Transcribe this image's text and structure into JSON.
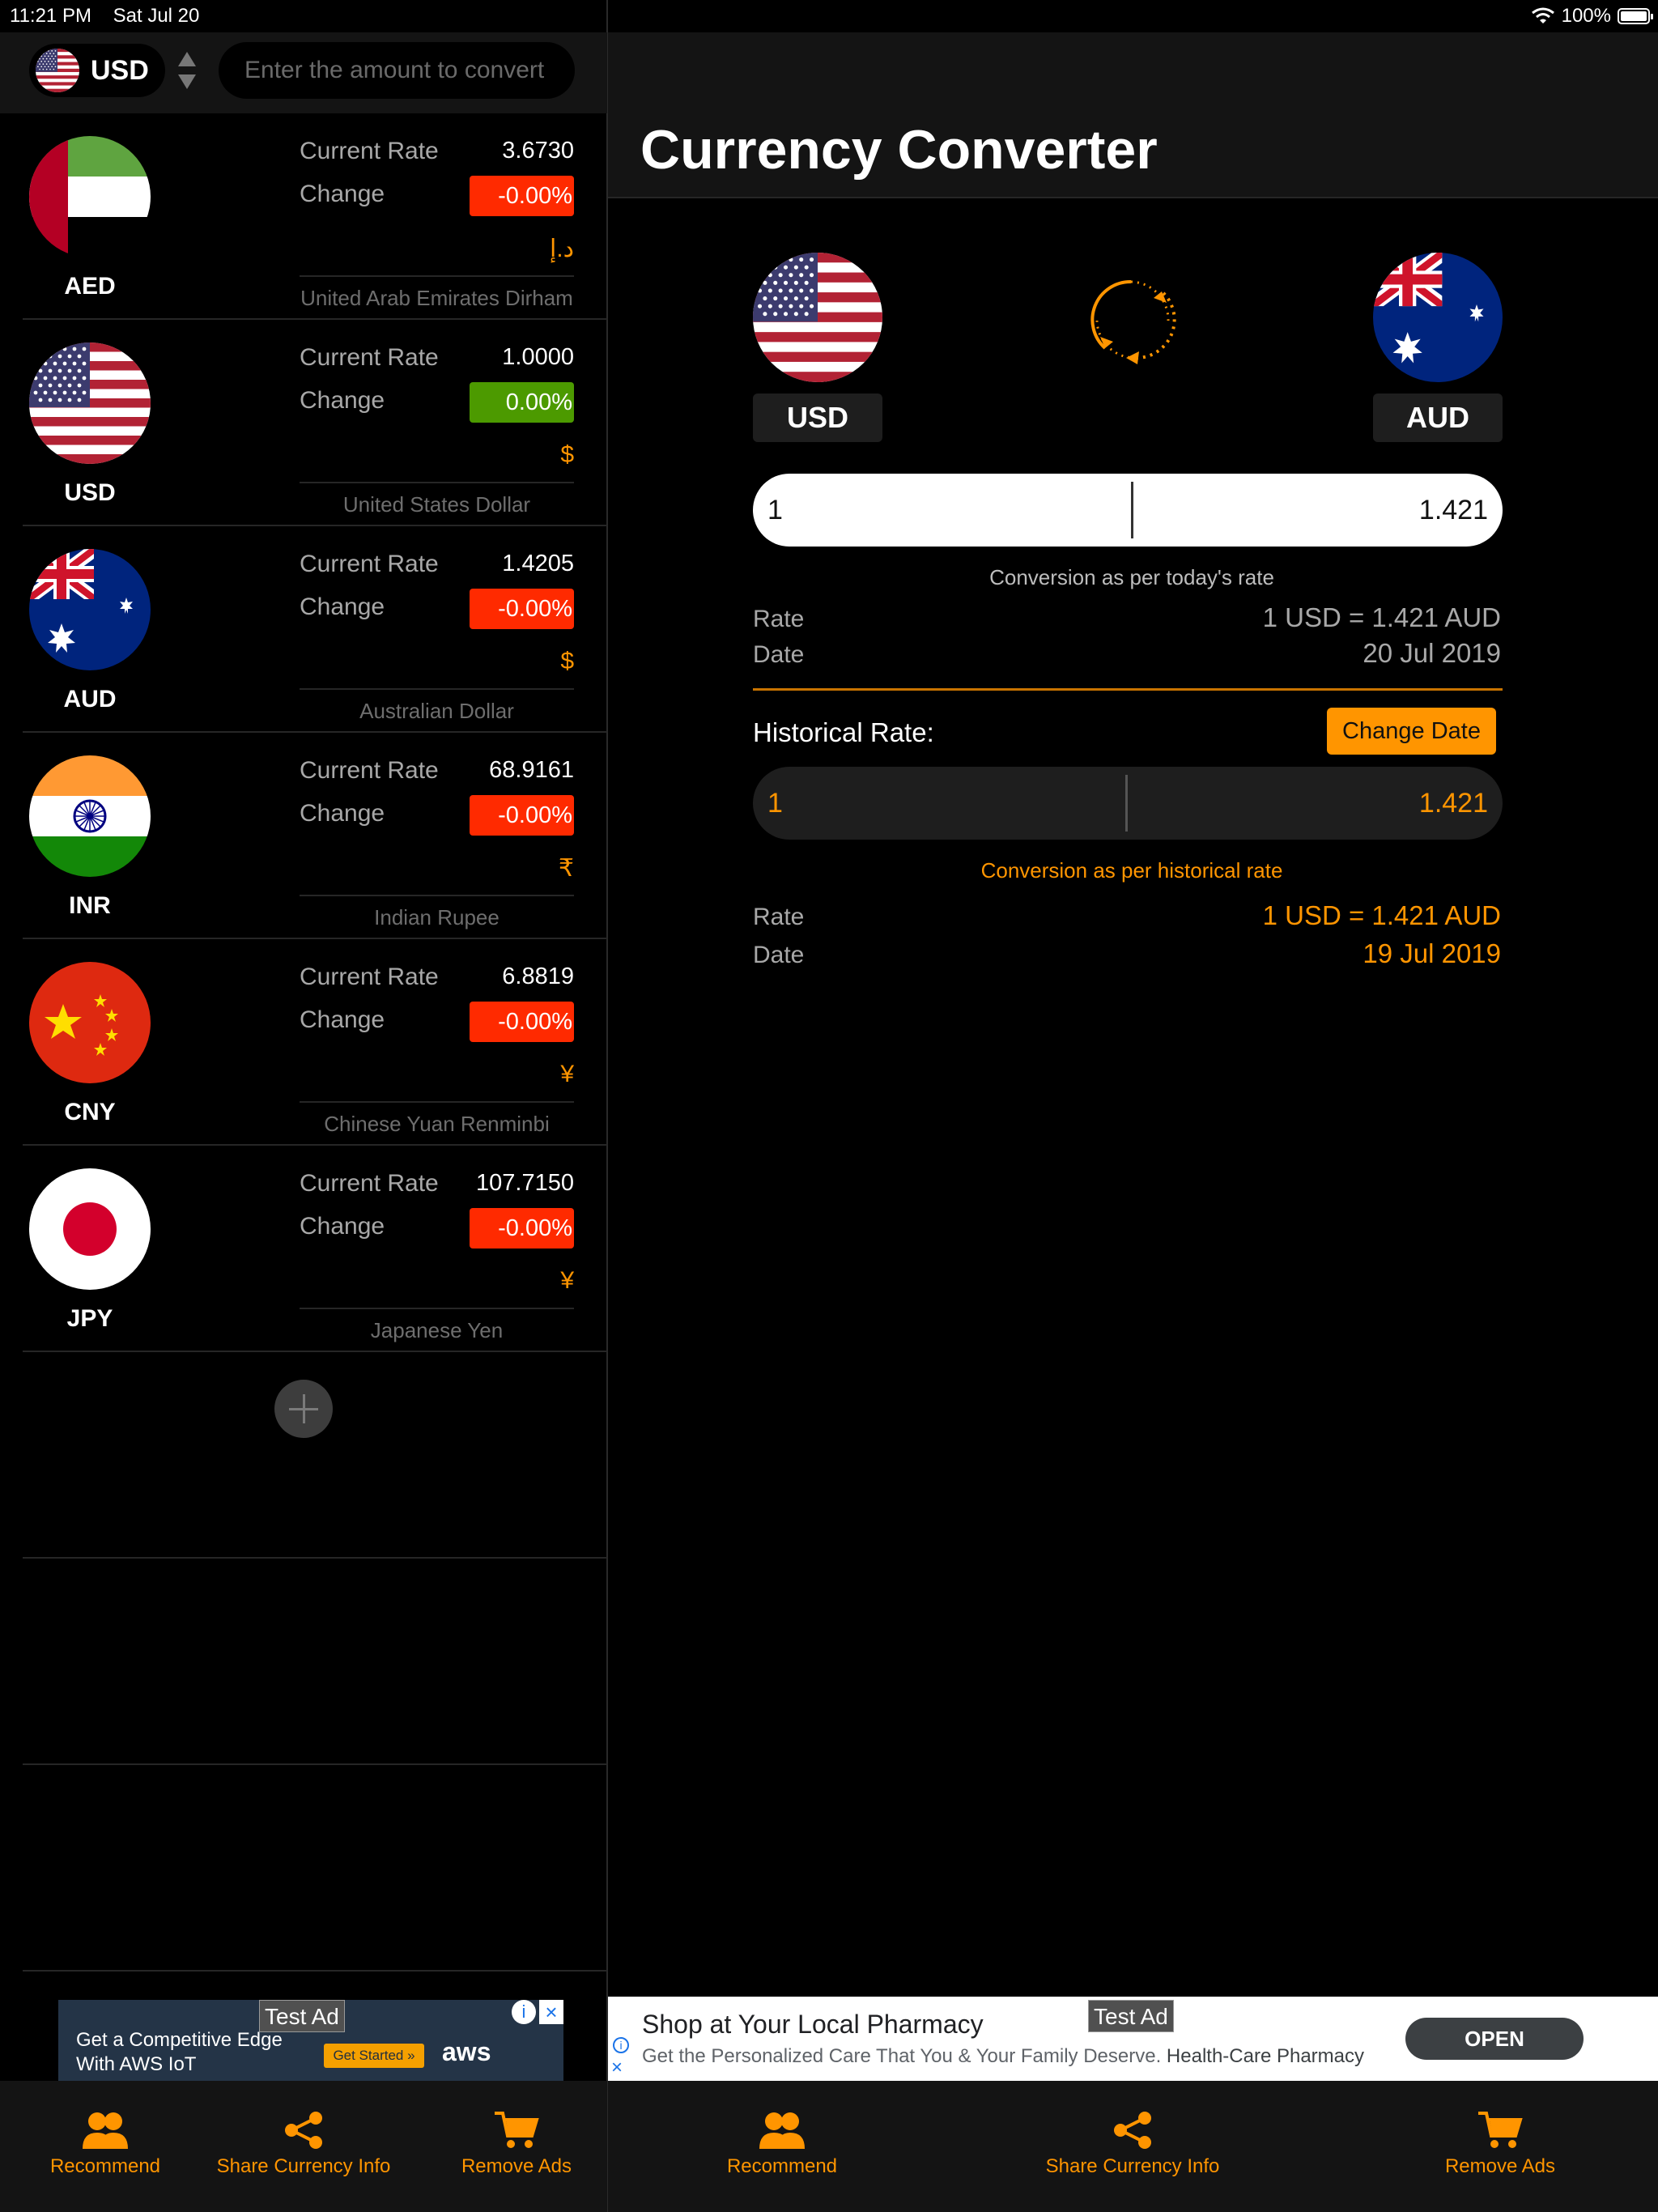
{
  "status_bar": {
    "time": "11:21 PM",
    "date": "Sat Jul 20",
    "battery": "100%",
    "battery_level": 1.0
  },
  "left": {
    "base_currency": "USD",
    "amount_placeholder": "Enter the amount to convert",
    "rate_label": "Current Rate",
    "change_label": "Change",
    "currencies": [
      {
        "code": "AED",
        "rate": "3.6730",
        "change": "-0.00%",
        "symbol": "د.إ",
        "name": "United Arab Emirates Dirham"
      },
      {
        "code": "USD",
        "rate": "1.0000",
        "change": "0.00%",
        "symbol": "$",
        "name": "United States Dollar"
      },
      {
        "code": "AUD",
        "rate": "1.4205",
        "change": "-0.00%",
        "symbol": "$",
        "name": "Australian Dollar"
      },
      {
        "code": "INR",
        "rate": "68.9161",
        "change": "-0.00%",
        "symbol": "₹",
        "name": "Indian Rupee"
      },
      {
        "code": "CNY",
        "rate": "6.8819",
        "change": "-0.00%",
        "symbol": "¥",
        "name": "Chinese Yuan Renminbi"
      },
      {
        "code": "JPY",
        "rate": "107.7150",
        "change": "-0.00%",
        "symbol": "¥",
        "name": "Japanese Yen"
      }
    ],
    "ad": {
      "badge": "Test Ad",
      "line1": "Get a Competitive Edge",
      "line2": "With AWS IoT",
      "cta": "Get Started »",
      "brand": "aws"
    },
    "tabs": {
      "recommend": "Recommend",
      "share": "Share Currency Info",
      "remove_ads": "Remove Ads"
    }
  },
  "right": {
    "title": "Currency Converter",
    "from_code": "USD",
    "to_code": "AUD",
    "today": {
      "amount": "1",
      "result": "1.421",
      "note": "Conversion as per today's rate",
      "rate_label": "Rate",
      "rate_value": "1 USD = 1.421 AUD",
      "date_label": "Date",
      "date_value": "20 Jul 2019"
    },
    "historical": {
      "label": "Historical Rate:",
      "button": "Change Date",
      "amount": "1",
      "result": "1.421",
      "note": "Conversion as per historical rate",
      "rate_label": "Rate",
      "rate_value": "1 USD = 1.421 AUD",
      "date_label": "Date",
      "date_value": "19 Jul 2019"
    },
    "ad": {
      "badge": "Test Ad",
      "title": "Shop at Your Local Pharmacy",
      "description": "Get the Personalized Care That You & Your Family Deserve.",
      "advertiser": "Health-Care Pharmacy",
      "button": "OPEN"
    },
    "tabs": {
      "recommend": "Recommend",
      "share": "Share Currency Info",
      "remove_ads": "Remove Ads"
    }
  },
  "colors": {
    "accent": "#ff9500",
    "negative": "#ff2a00",
    "positive": "#4c9a00",
    "background": "#000000",
    "panel": "#141414"
  }
}
